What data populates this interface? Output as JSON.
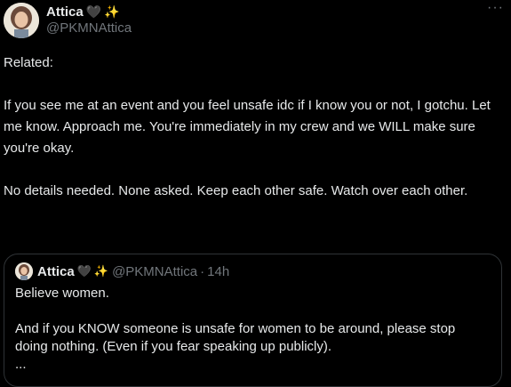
{
  "tweet": {
    "display_name": "Attica",
    "emoji_heart": "🖤",
    "emoji_sparkles": "✨",
    "handle": "@PKMNAttica",
    "more_label": "···",
    "paragraphs": [
      "Related:",
      "If you see me at an event and you feel unsafe idc if I know you or not, I gotchu. Let me know. Approach me. You're immediately in my crew and we WILL make sure you're okay.",
      "No details needed. None asked. Keep each other safe. Watch over each other."
    ]
  },
  "quoted": {
    "display_name": "Attica",
    "emoji_heart": "🖤",
    "emoji_sparkles": "✨",
    "handle": "@PKMNAttica",
    "dot": "·",
    "time": "14h",
    "paragraphs": [
      "Believe women.",
      "And if you KNOW someone is unsafe for women to be around, please stop doing nothing. (Even if you fear speaking up publicly).",
      "..."
    ]
  },
  "colors": {
    "background": "#000000",
    "text": "#e7e9ea",
    "muted": "#71767b",
    "border": "#2f3336"
  }
}
